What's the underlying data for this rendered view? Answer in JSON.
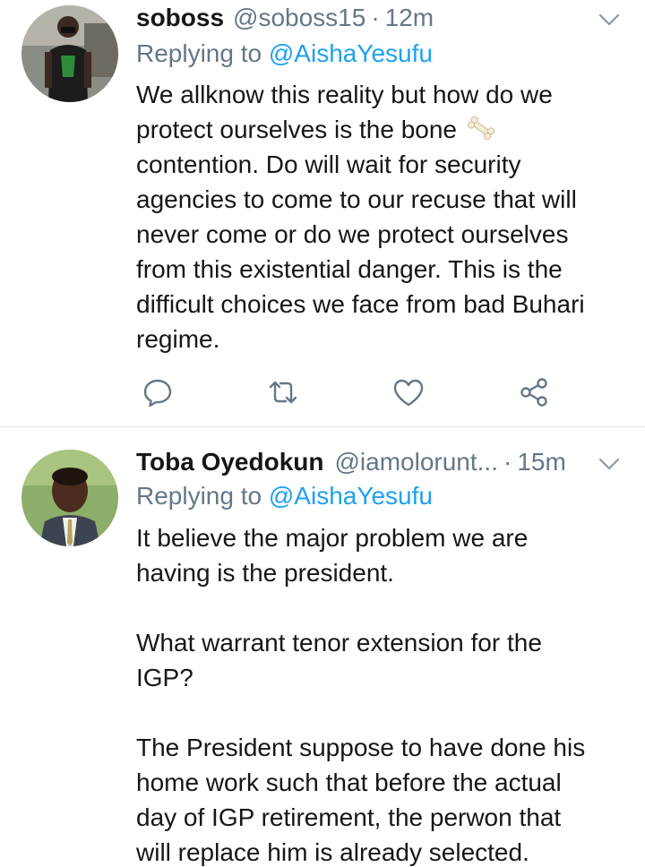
{
  "tweets": [
    {
      "name": "soboss",
      "handle": "@soboss15",
      "separator": "·",
      "time": "12m",
      "replying_prefix": "Replying to ",
      "replying_to": "@AishaYesufu",
      "body_part1": "We allknow this reality but how do we\nprotect ourselves is the bone ",
      "emoji": "bone-emoji",
      "body_part2": "\ncontention. Do will wait for security\nagencies to come to our recuse  that will\nnever come or do we protect ourselves\nfrom this existential danger. This is the\ndifficult choices we face from bad Buhari\nregime.",
      "actions": [
        "reply-icon",
        "retweet-icon",
        "like-icon",
        "share-icon"
      ]
    },
    {
      "name": "Toba Oyedokun",
      "handle": "@iamolorunt...",
      "separator": "·",
      "time": "15m",
      "replying_prefix": "Replying to ",
      "replying_to": "@AishaYesufu",
      "body": "It believe the major problem we are\nhaving is the president.\n\nWhat warrant tenor extension for the\nIGP?\n\nThe President suppose to have done his\nhome work such that before the actual\nday of IGP retirement, the perwon that\nwill replace him is already selected."
    }
  ],
  "colors": {
    "text": "#14171a",
    "muted": "#657786",
    "link": "#1da1f2",
    "divider": "#e1e8ed"
  }
}
